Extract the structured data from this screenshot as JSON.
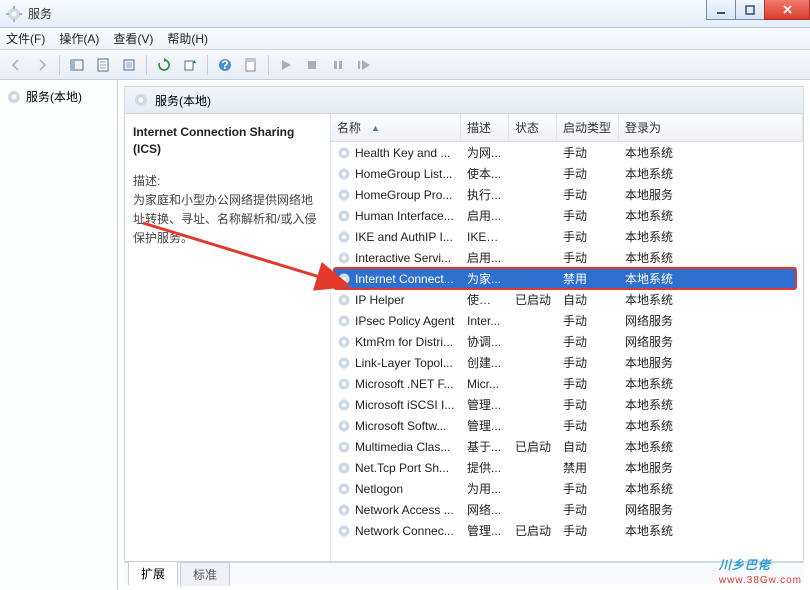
{
  "window": {
    "title": "服务"
  },
  "menu": {
    "file": "文件(F)",
    "action": "操作(A)",
    "view": "查看(V)",
    "help": "帮助(H)"
  },
  "tree": {
    "root": "服务(本地)"
  },
  "right_header": {
    "title": "服务(本地)"
  },
  "detail": {
    "title": "Internet Connection Sharing (ICS)",
    "desc_label": "描述:",
    "desc": "为家庭和小型办公网络提供网络地址转换、寻址、名称解析和/或入侵保护服务。"
  },
  "columns": {
    "name": "名称",
    "desc": "描述",
    "status": "状态",
    "startup": "启动类型",
    "logon": "登录为"
  },
  "services": [
    {
      "name": "Health Key and ...",
      "desc": "为网...",
      "status": "",
      "startup": "手动",
      "logon": "本地系统"
    },
    {
      "name": "HomeGroup List...",
      "desc": "使本...",
      "status": "",
      "startup": "手动",
      "logon": "本地系统"
    },
    {
      "name": "HomeGroup Pro...",
      "desc": "执行...",
      "status": "",
      "startup": "手动",
      "logon": "本地服务"
    },
    {
      "name": "Human Interface...",
      "desc": "启用...",
      "status": "",
      "startup": "手动",
      "logon": "本地系统"
    },
    {
      "name": "IKE and AuthIP I...",
      "desc": "IKEE...",
      "status": "",
      "startup": "手动",
      "logon": "本地系统"
    },
    {
      "name": "Interactive Servi...",
      "desc": "启用...",
      "status": "",
      "startup": "手动",
      "logon": "本地系统"
    },
    {
      "name": "Internet Connect...",
      "desc": "为家...",
      "status": "",
      "startup": "禁用",
      "logon": "本地系统",
      "selected": true
    },
    {
      "name": "IP Helper",
      "desc": "使用 ...",
      "status": "已启动",
      "startup": "自动",
      "logon": "本地系统"
    },
    {
      "name": "IPsec Policy Agent",
      "desc": "Inter...",
      "status": "",
      "startup": "手动",
      "logon": "网络服务"
    },
    {
      "name": "KtmRm for Distri...",
      "desc": "协调...",
      "status": "",
      "startup": "手动",
      "logon": "网络服务"
    },
    {
      "name": "Link-Layer Topol...",
      "desc": "创建...",
      "status": "",
      "startup": "手动",
      "logon": "本地服务"
    },
    {
      "name": "Microsoft .NET F...",
      "desc": "Micr...",
      "status": "",
      "startup": "手动",
      "logon": "本地系统"
    },
    {
      "name": "Microsoft iSCSI I...",
      "desc": "管理...",
      "status": "",
      "startup": "手动",
      "logon": "本地系统"
    },
    {
      "name": "Microsoft Softw...",
      "desc": "管理...",
      "status": "",
      "startup": "手动",
      "logon": "本地系统"
    },
    {
      "name": "Multimedia Clas...",
      "desc": "基于...",
      "status": "已启动",
      "startup": "自动",
      "logon": "本地系统"
    },
    {
      "name": "Net.Tcp Port Sh...",
      "desc": "提供...",
      "status": "",
      "startup": "禁用",
      "logon": "本地服务"
    },
    {
      "name": "Netlogon",
      "desc": "为用...",
      "status": "",
      "startup": "手动",
      "logon": "本地系统"
    },
    {
      "name": "Network Access ...",
      "desc": "网络...",
      "status": "",
      "startup": "手动",
      "logon": "网络服务"
    },
    {
      "name": "Network Connec...",
      "desc": "管理...",
      "status": "已启动",
      "startup": "手动",
      "logon": "本地系统"
    }
  ],
  "tabs": {
    "extended": "扩展",
    "standard": "标准"
  },
  "watermark": {
    "text": "川乡巴佬",
    "url": "www.38Gw.com"
  }
}
